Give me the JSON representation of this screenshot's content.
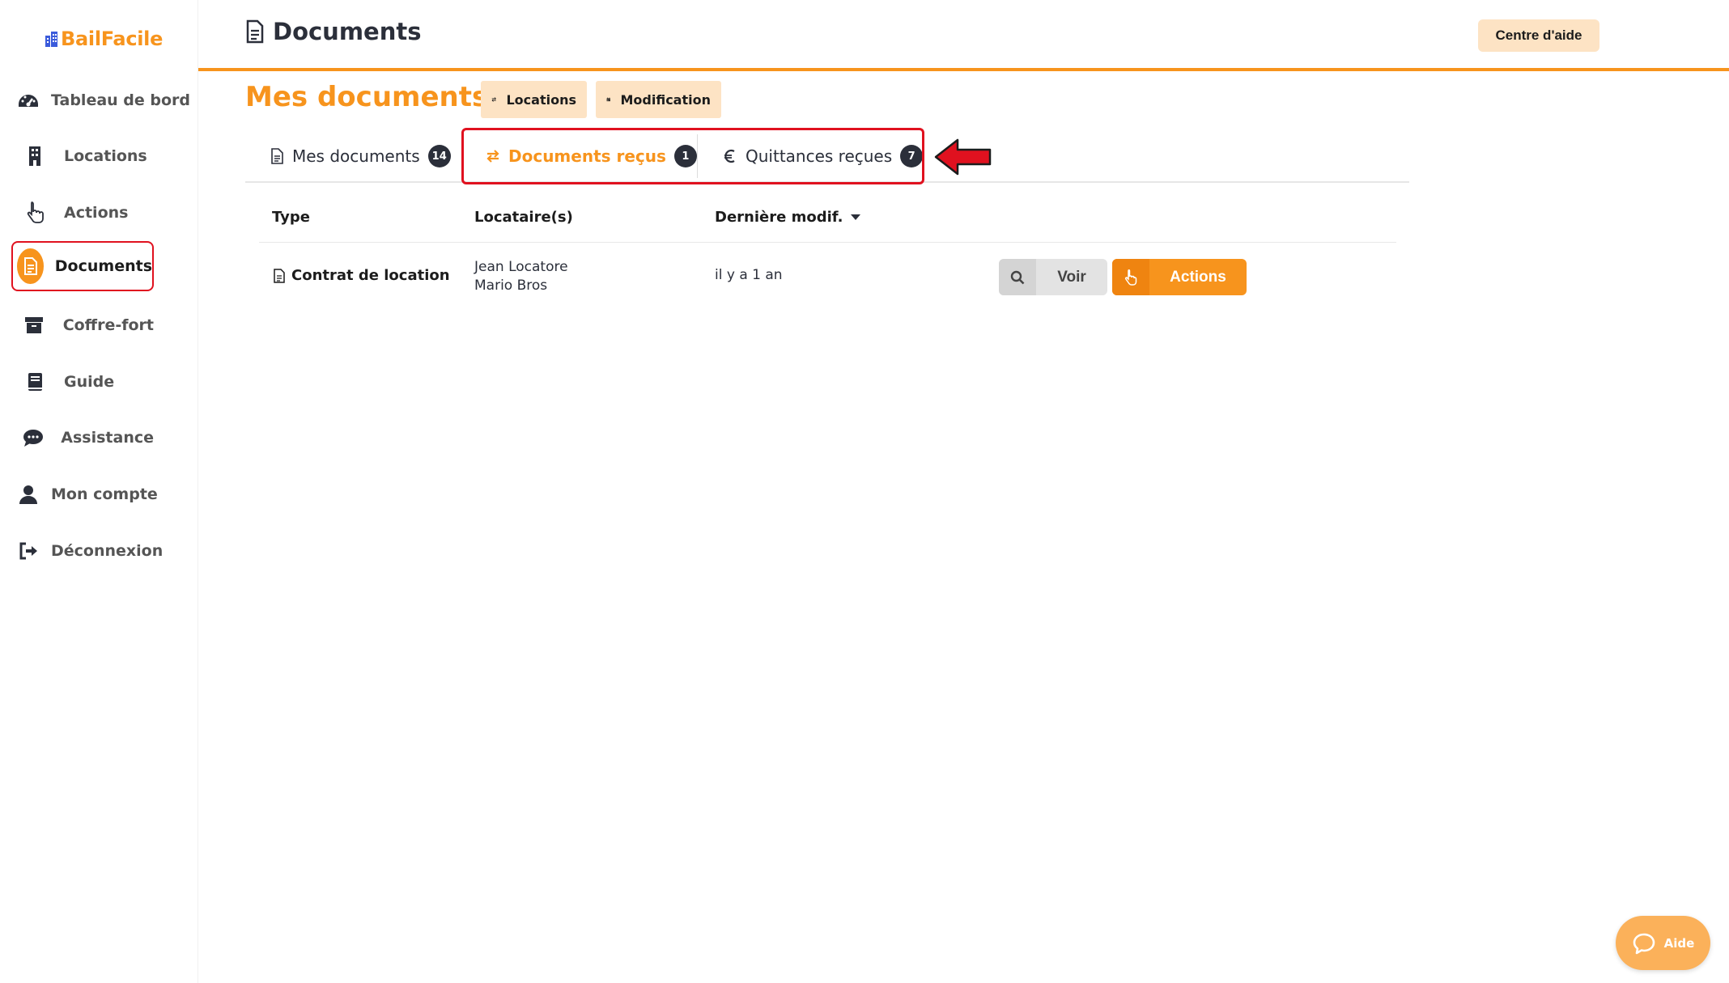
{
  "brand": {
    "name": "BailFacile",
    "color": "#f7941d"
  },
  "sidebar": {
    "items": [
      {
        "label": "Tableau de bord",
        "icon": "dashboard-gauge-icon"
      },
      {
        "label": "Locations",
        "icon": "building-icon"
      },
      {
        "label": "Actions",
        "icon": "hand-pointer-icon"
      },
      {
        "label": "Documents",
        "icon": "document-icon",
        "active": true
      },
      {
        "label": "Coffre-fort",
        "icon": "archive-box-icon"
      },
      {
        "label": "Guide",
        "icon": "book-icon"
      },
      {
        "label": "Assistance",
        "icon": "chat-bubble-icon"
      },
      {
        "label": "Mon compte",
        "icon": "user-icon"
      },
      {
        "label": "Déconnexion",
        "icon": "sign-out-icon"
      }
    ]
  },
  "header": {
    "title": "Documents",
    "help_label": "Centre d'aide"
  },
  "main": {
    "title": "Mes documents",
    "chips": [
      {
        "label": "Locations",
        "icon": "exchange-arrows-icon"
      },
      {
        "label": "Modification",
        "icon": "calendar-icon"
      }
    ],
    "tabs": [
      {
        "label": "Mes documents",
        "count": "14",
        "icon": "document-icon"
      },
      {
        "label": "Documents reçus",
        "count": "1",
        "icon": "exchange-arrows-icon",
        "active": true
      },
      {
        "label": "Quittances reçues",
        "count": "7",
        "icon": "euro-icon"
      }
    ]
  },
  "table": {
    "columns": [
      "Type",
      "Locataire(s)",
      "Dernière modif."
    ],
    "rows": [
      {
        "type": "Contrat de location",
        "tenants": [
          "Jean Locatore",
          "Mario Bros"
        ],
        "modified": "il y a 1 an",
        "view_label": "Voir",
        "actions_label": "Actions"
      }
    ]
  },
  "help_widget": {
    "label": "Aide"
  },
  "colors": {
    "accent": "#f7941d",
    "accent_light": "#fde3c4",
    "annotation": "#e0111f",
    "dark": "#2b2f3a"
  }
}
